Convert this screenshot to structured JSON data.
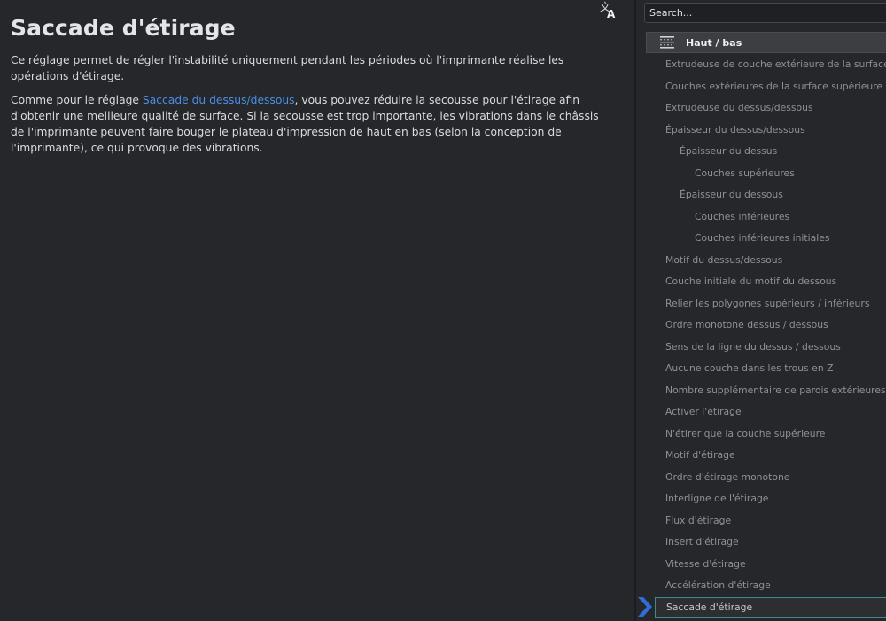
{
  "article": {
    "title": "Saccade d'étirage",
    "p1": "Ce réglage permet de régler l'instabilité uniquement pendant les périodes où l'imprimante réalise les opérations d'étirage.",
    "p2_before": "Comme pour le réglage ",
    "p2_link": "Saccade du dessus/dessous",
    "p2_after": ", vous pouvez réduire la secousse pour l'étirage afin d'obtenir une meilleure qualité de surface. Si la secousse est trop importante, les vibrations dans le châssis de l'imprimante peuvent faire bouger le plateau d'impression de haut en bas (selon la conception de l'imprimante), ce qui provoque des vibrations."
  },
  "panel": {
    "search_placeholder": "Search...",
    "category_label": "Haut / bas",
    "items": [
      {
        "label": "Extrudeuse de couche extérieure de la surface supérieure",
        "level": 0
      },
      {
        "label": "Couches extérieures de la surface supérieure",
        "level": 0
      },
      {
        "label": "Extrudeuse du dessus/dessous",
        "level": 0
      },
      {
        "label": "Épaisseur du dessus/dessous",
        "level": 0
      },
      {
        "label": "Épaisseur du dessus",
        "level": 1
      },
      {
        "label": "Couches supérieures",
        "level": 2
      },
      {
        "label": "Épaisseur du dessous",
        "level": 1
      },
      {
        "label": "Couches inférieures",
        "level": 2
      },
      {
        "label": "Couches inférieures initiales",
        "level": 2
      },
      {
        "label": "Motif du dessus/dessous",
        "level": 0
      },
      {
        "label": "Couche initiale du motif du dessous",
        "level": 0
      },
      {
        "label": "Relier les polygones supérieurs / inférieurs",
        "level": 0
      },
      {
        "label": "Ordre monotone dessus / dessous",
        "level": 0
      },
      {
        "label": "Sens de la ligne du dessus / dessous",
        "level": 0
      },
      {
        "label": "Aucune couche dans les trous en Z",
        "level": 0
      },
      {
        "label": "Nombre supplémentaire de parois extérieures",
        "level": 0
      },
      {
        "label": "Activer l'étirage",
        "level": 0
      },
      {
        "label": "N'étirer que la couche supérieure",
        "level": 0
      },
      {
        "label": "Motif d'étirage",
        "level": 0
      },
      {
        "label": "Ordre d'étirage monotone",
        "level": 0
      },
      {
        "label": "Interligne de l'étirage",
        "level": 0
      },
      {
        "label": "Flux d'étirage",
        "level": 0
      },
      {
        "label": "Insert d'étirage",
        "level": 0
      },
      {
        "label": "Vitesse d'étirage",
        "level": 0
      },
      {
        "label": "Accélération d'étirage",
        "level": 0
      },
      {
        "label": "Saccade d'étirage",
        "level": 0,
        "selected": true
      }
    ]
  },
  "colors": {
    "background": "#25272b",
    "link": "#4a8ee6",
    "selection_border": "#3a8c8f",
    "selection_arrow": "#2d6fd6"
  },
  "icons": {
    "translate": "translate-icon",
    "category": "top-bottom-icon",
    "selection": "chevron-right-icon"
  }
}
